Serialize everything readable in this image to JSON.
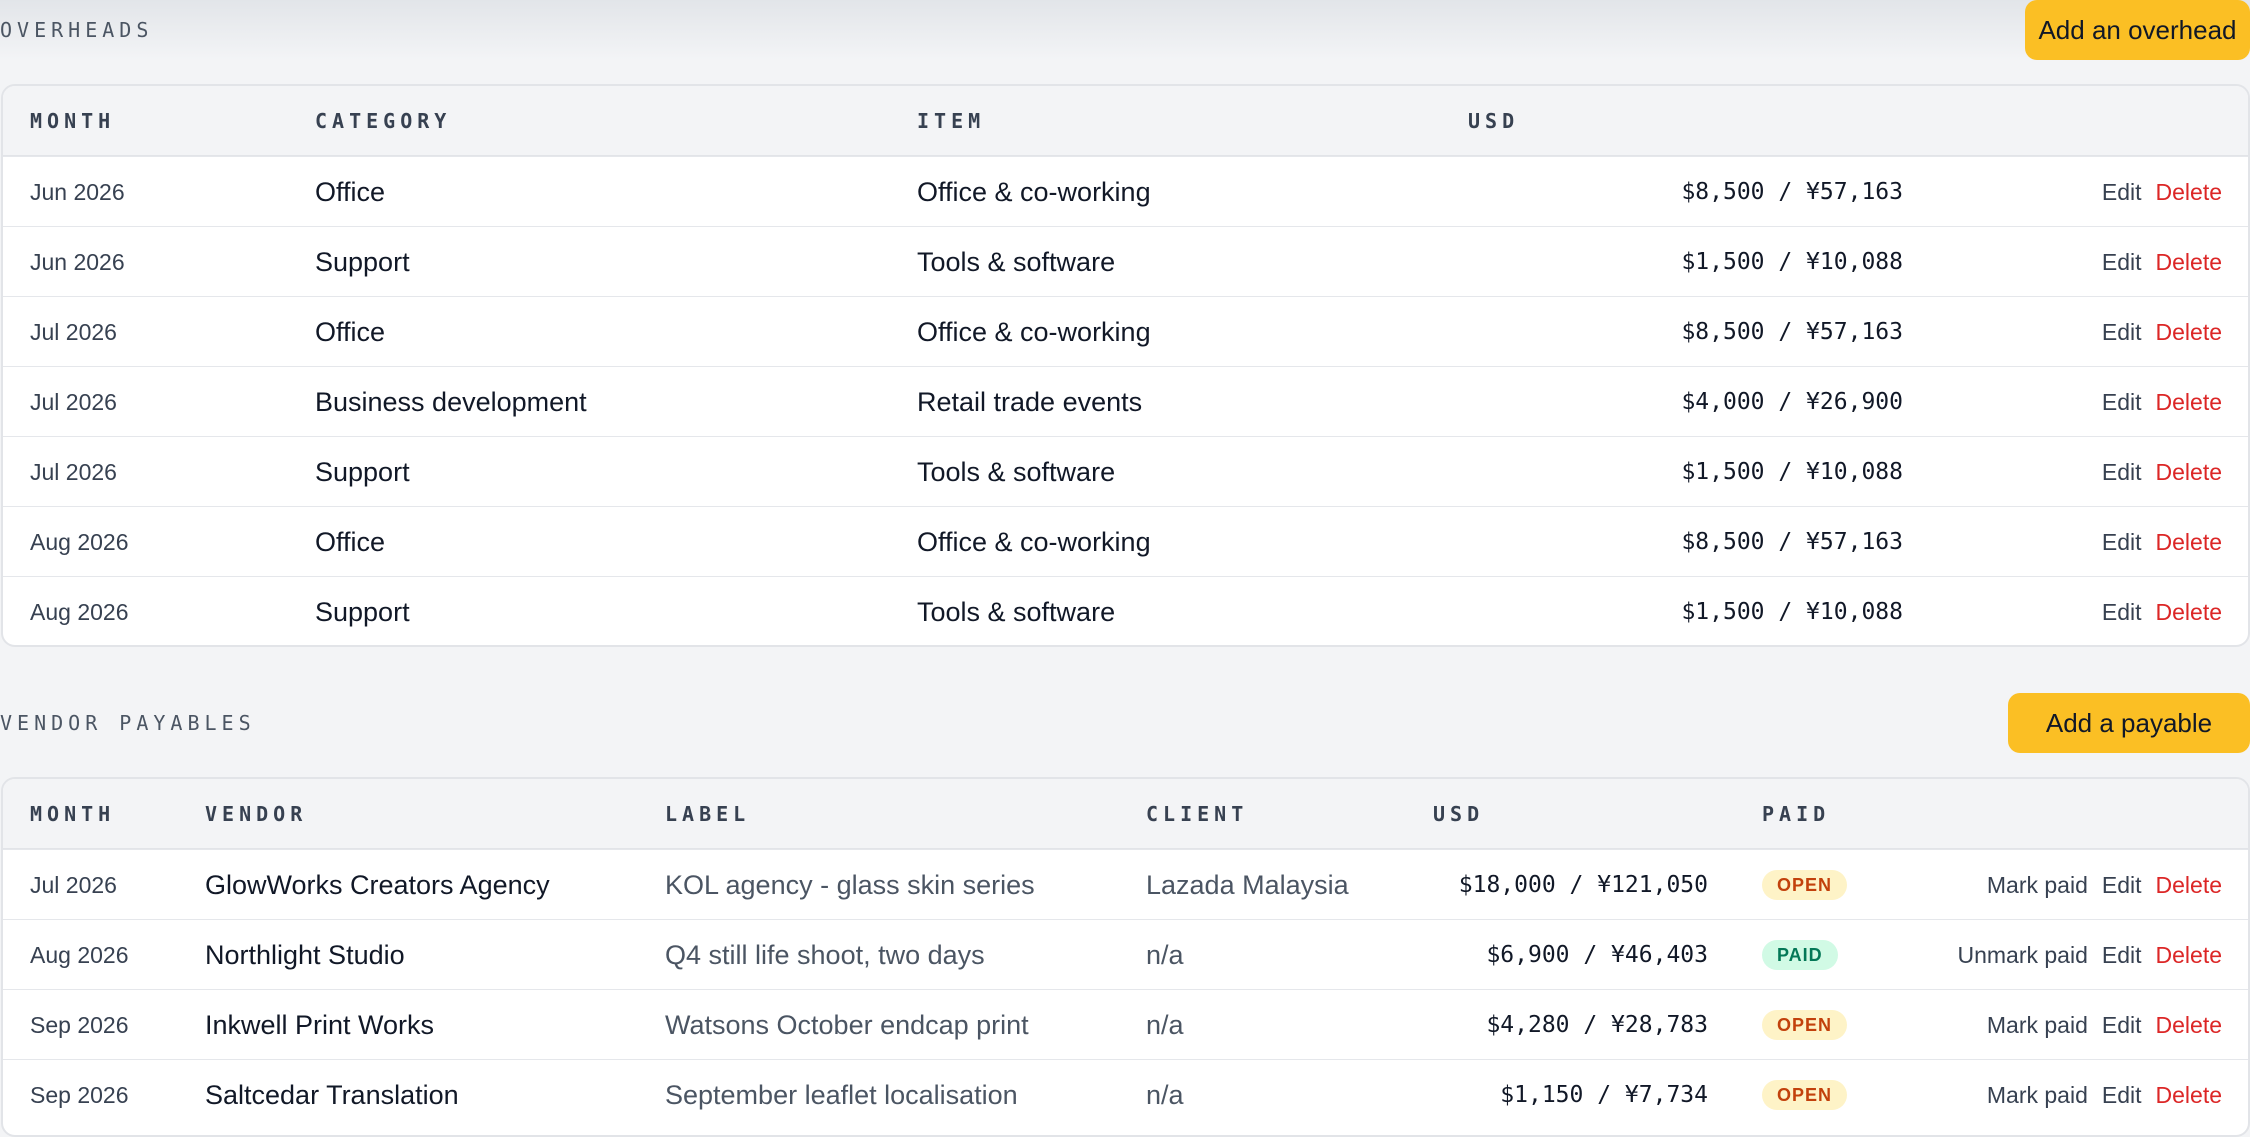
{
  "overheads": {
    "title": "OVERHEADS",
    "add_button": "Add an overhead",
    "columns": [
      "MONTH",
      "CATEGORY",
      "ITEM",
      "USD"
    ],
    "rows": [
      {
        "month": "Jun 2026",
        "category": "Office",
        "item": "Office & co-working",
        "amount": "$8,500 / ¥57,163"
      },
      {
        "month": "Jun 2026",
        "category": "Support",
        "item": "Tools & software",
        "amount": "$1,500 / ¥10,088"
      },
      {
        "month": "Jul 2026",
        "category": "Office",
        "item": "Office & co-working",
        "amount": "$8,500 / ¥57,163"
      },
      {
        "month": "Jul 2026",
        "category": "Business development",
        "item": "Retail trade events",
        "amount": "$4,000 / ¥26,900"
      },
      {
        "month": "Jul 2026",
        "category": "Support",
        "item": "Tools & software",
        "amount": "$1,500 / ¥10,088"
      },
      {
        "month": "Aug 2026",
        "category": "Office",
        "item": "Office & co-working",
        "amount": "$8,500 / ¥57,163"
      },
      {
        "month": "Aug 2026",
        "category": "Support",
        "item": "Tools & software",
        "amount": "$1,500 / ¥10,088"
      }
    ]
  },
  "payables": {
    "title": "VENDOR PAYABLES",
    "add_button": "Add a payable",
    "columns": [
      "MONTH",
      "VENDOR",
      "LABEL",
      "CLIENT",
      "USD",
      "PAID"
    ],
    "rows": [
      {
        "month": "Jul 2026",
        "vendor": "GlowWorks Creators Agency",
        "label": "KOL agency - glass skin series",
        "client": "Lazada Malaysia",
        "amount": "$18,000 / ¥121,050",
        "status": "OPEN",
        "toggle": "Mark paid"
      },
      {
        "month": "Aug 2026",
        "vendor": "Northlight Studio",
        "label": "Q4 still life shoot, two days",
        "client": "n/a",
        "amount": "$6,900 / ¥46,403",
        "status": "PAID",
        "toggle": "Unmark paid"
      },
      {
        "month": "Sep 2026",
        "vendor": "Inkwell Print Works",
        "label": "Watsons October endcap print",
        "client": "n/a",
        "amount": "$4,280 / ¥28,783",
        "status": "OPEN",
        "toggle": "Mark paid"
      },
      {
        "month": "Sep 2026",
        "vendor": "Saltcedar Translation",
        "label": "September leaflet localisation",
        "client": "n/a",
        "amount": "$1,150 / ¥7,734",
        "status": "OPEN",
        "toggle": "Mark paid"
      }
    ]
  },
  "actions": {
    "edit": "Edit",
    "delete": "Delete"
  },
  "colors": {
    "accent": "#fbbf24",
    "danger": "#dc2626",
    "open_badge": "#fef3c7",
    "paid_badge": "#d1fae5"
  }
}
